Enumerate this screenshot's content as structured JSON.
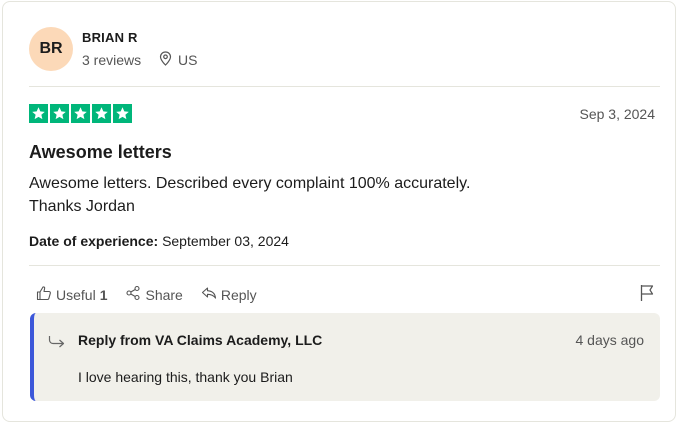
{
  "user": {
    "initials": "BR",
    "name": "BRIAN R",
    "reviews": "3 reviews",
    "country": "US"
  },
  "review": {
    "rating": 5,
    "date": "Sep 3, 2024",
    "title": "Awesome letters",
    "body_line1": "Awesome letters. Described every complaint 100% accurately.",
    "body_line2": "Thanks Jordan",
    "experience_label": "Date of experience:",
    "experience_date": "September 03, 2024"
  },
  "actions": {
    "useful_label": "Useful",
    "useful_count": "1",
    "share_label": "Share",
    "reply_label": "Reply"
  },
  "reply": {
    "title": "Reply from VA Claims Academy, LLC",
    "date": "4 days ago",
    "text": "I love hearing this, thank you Brian"
  },
  "colors": {
    "star_green": "#00b67a",
    "avatar_bg": "#fcd9b8",
    "reply_accent": "#3c57d9",
    "reply_bg": "#f1f0ea"
  },
  "icons": [
    "location-pin-icon",
    "star-icon",
    "thumbs-up-icon",
    "share-icon",
    "reply-icon",
    "flag-icon",
    "reply-arrow-icon"
  ]
}
